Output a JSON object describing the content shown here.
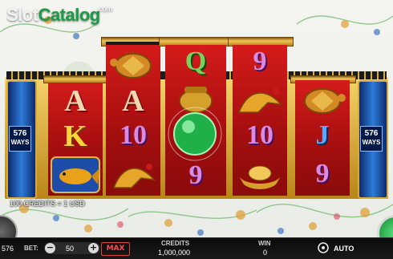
{
  "logo": {
    "part1": "Slot",
    "part2": "Catalog",
    "part3": ".com"
  },
  "ways": {
    "left": {
      "num": "576",
      "label": "WAYS"
    },
    "right": {
      "num": "576",
      "label": "WAYS"
    }
  },
  "reels": {
    "r1": [
      "A",
      "K"
    ],
    "r2": [
      "A",
      "10"
    ],
    "r3": [
      "Q",
      "9"
    ],
    "r4": [
      "9",
      "10"
    ],
    "r5": [
      "J",
      "9"
    ]
  },
  "icons": [
    "turtle-icon",
    "koi-fish-icon",
    "crane-bird-icon",
    "gold-pot-icon",
    "jade-orb-icon",
    "gold-ingot-icon"
  ],
  "info": {
    "credits_line": "100 CREDITS = 1 USD"
  },
  "bar": {
    "left_num": "576",
    "bet_label": "BET:",
    "bet_value": "50",
    "minus": "−",
    "plus": "+",
    "max": "MAX",
    "credits_label": "CREDITS",
    "credits_value": "1,000,000",
    "win_label": "WIN",
    "win_value": "0",
    "auto_label": "AUTO"
  },
  "colors": {
    "accent_green": "#1d9b46",
    "reel_red": "#c2161a",
    "gold": "#e1b33b"
  }
}
